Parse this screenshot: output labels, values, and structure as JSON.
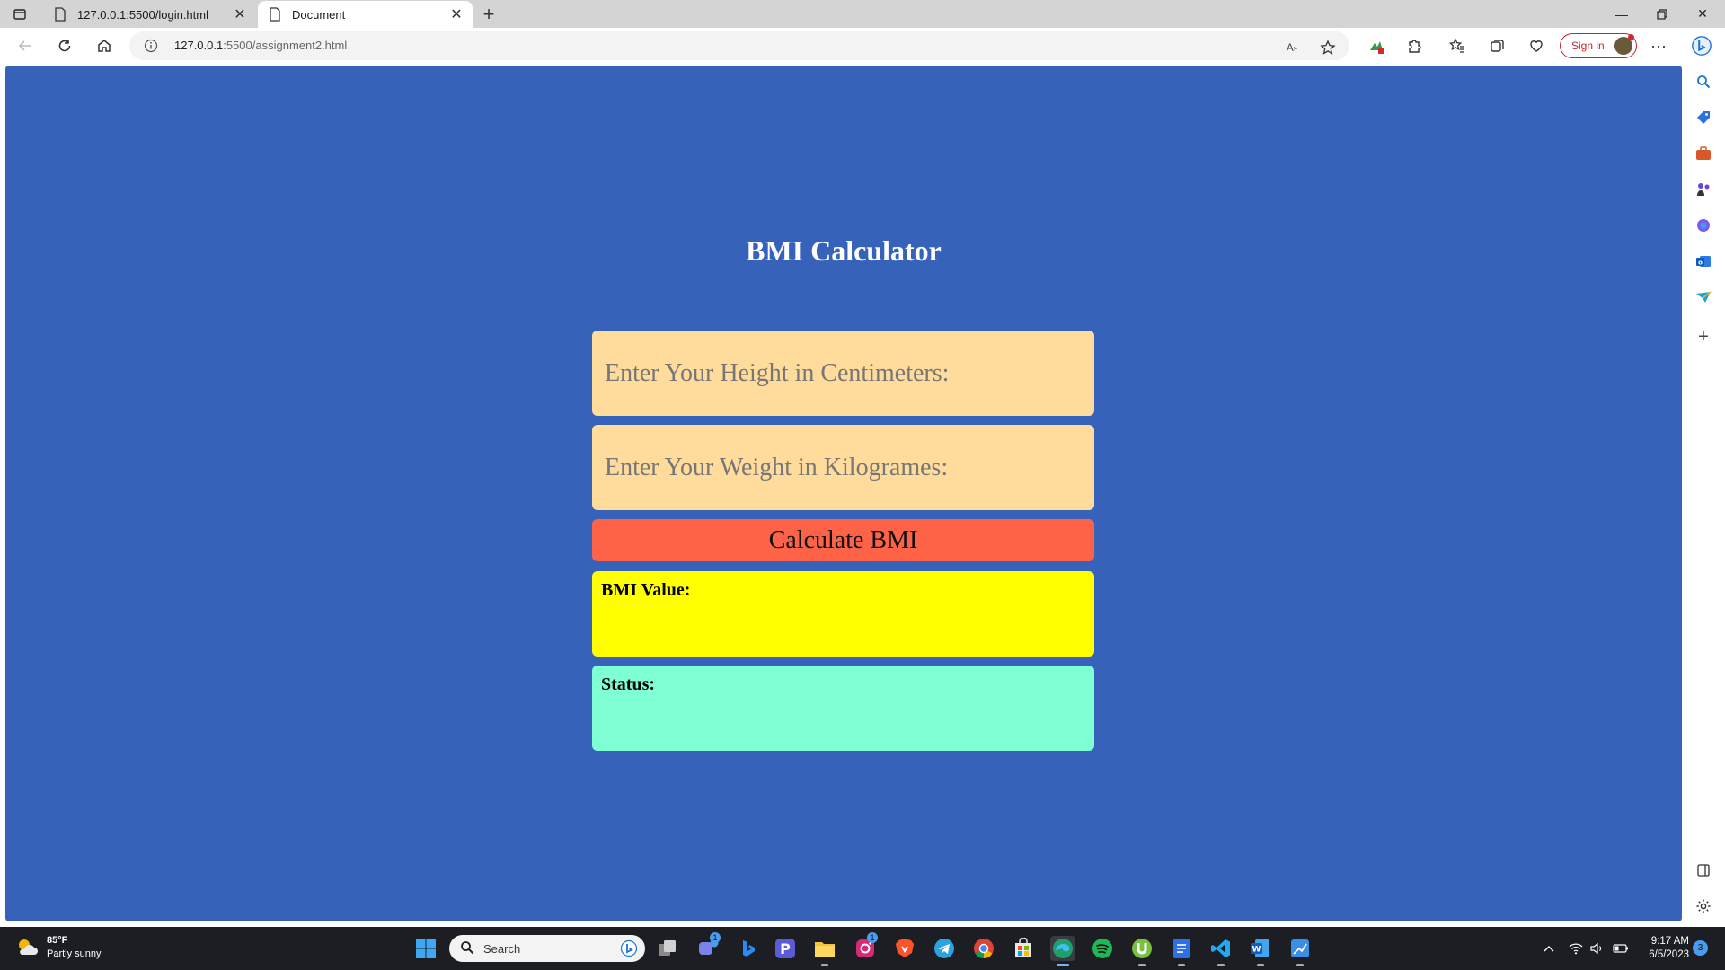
{
  "browser": {
    "tabs": [
      {
        "title": "127.0.0.1:5500/login.html",
        "active": false
      },
      {
        "title": "Document",
        "active": true
      }
    ],
    "address": {
      "host": "127.0.0.1",
      "path": ":5500/assignment2.html"
    },
    "sign_in_label": "Sign in"
  },
  "page": {
    "title": "BMI Calculator",
    "height_placeholder": "Enter Your Height in Centimeters:",
    "weight_placeholder": "Enter Your Weight in Kilogrames:",
    "calculate_label": "Calculate BMI",
    "bmi_label": "BMI Value:",
    "status_label": "Status:"
  },
  "colors": {
    "page_bg": "#3663b9",
    "input_bg": "#ffdb9c",
    "button_bg": "#ff6347",
    "bmi_bg": "#ffff00",
    "status_bg": "#7fffd4"
  },
  "taskbar": {
    "weather_temp": "85°F",
    "weather_desc": "Partly sunny",
    "search_placeholder": "Search",
    "time": "9:17 AM",
    "date": "6/5/2023",
    "notification_count": "3",
    "teams_badge": "1",
    "instagram_badge": "1"
  }
}
